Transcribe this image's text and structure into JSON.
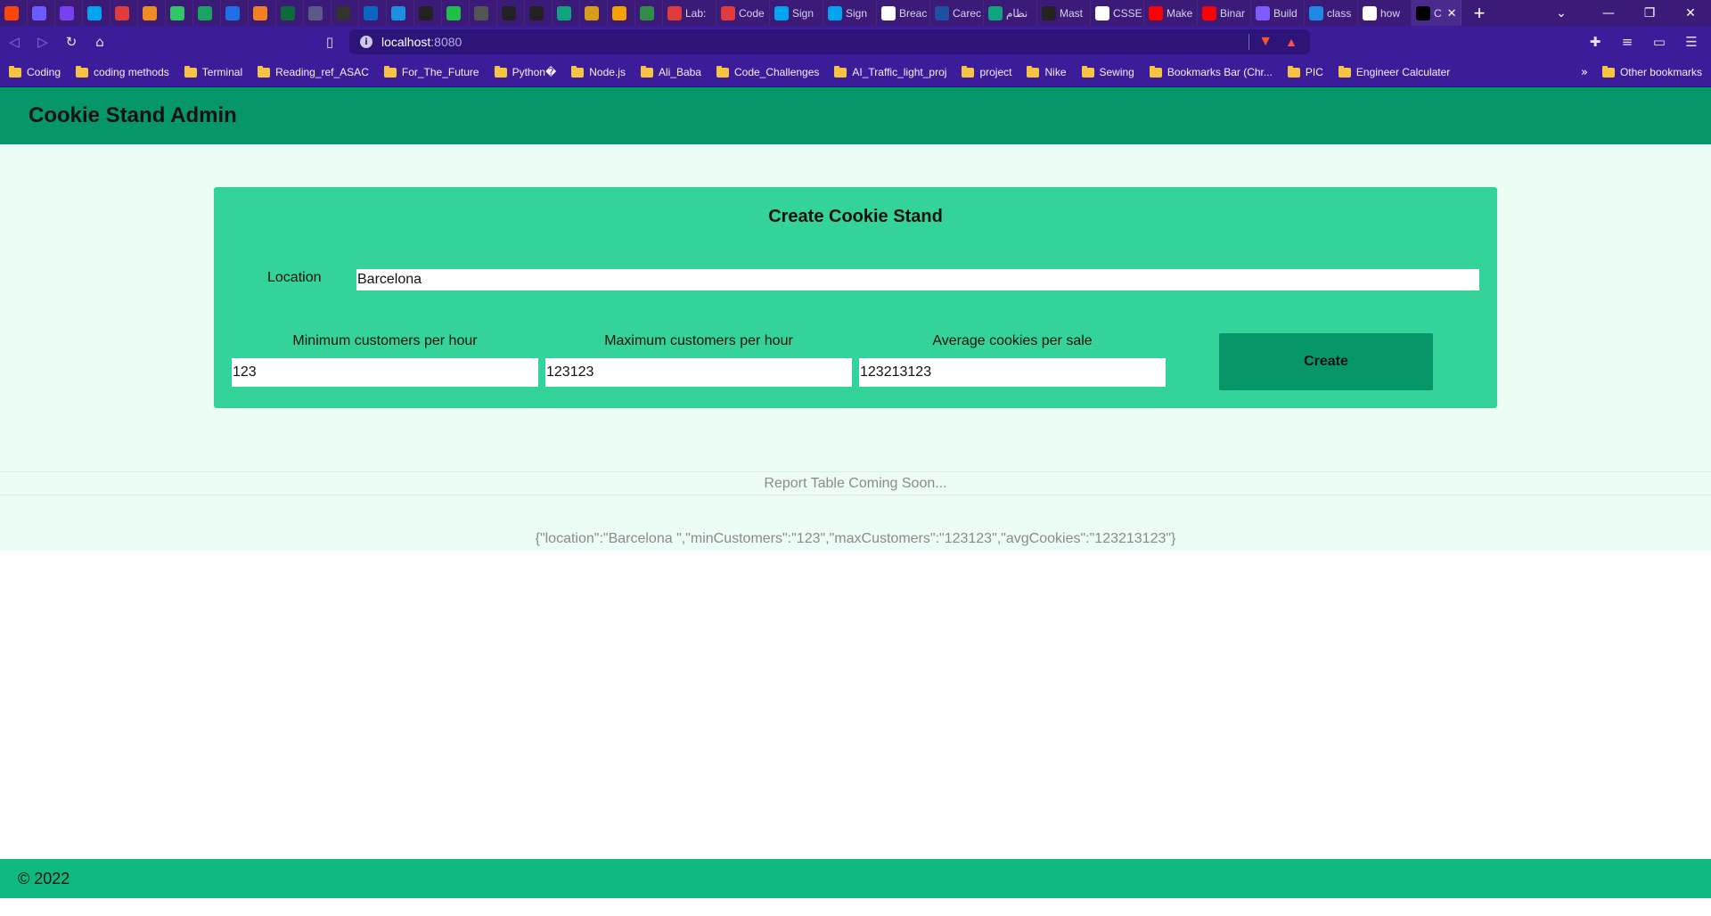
{
  "browser": {
    "tabs": [
      {
        "label": "",
        "icon": "reddit-icon",
        "color": "#ff4500"
      },
      {
        "label": "",
        "icon": "swirl-icon",
        "color": "#6b5cff"
      },
      {
        "label": "",
        "icon": "d-icon",
        "color": "#7b3ff2"
      },
      {
        "label": "",
        "icon": "microsoft-icon",
        "color": "#00a4ef"
      },
      {
        "label": "",
        "icon": "ring-icon",
        "color": "#e23b3b"
      },
      {
        "label": "",
        "icon": "pdf-icon",
        "color": "#f08c24"
      },
      {
        "label": "",
        "icon": "tc-icon",
        "color": "#2ec866"
      },
      {
        "label": "",
        "icon": "phone-icon",
        "color": "#1aa260"
      },
      {
        "label": "",
        "icon": "c-icon",
        "color": "#1e6fe8"
      },
      {
        "label": "",
        "icon": "stack-icon",
        "color": "#f48024"
      },
      {
        "label": "",
        "icon": "hr-icon",
        "color": "#0b6b3a"
      },
      {
        "label": "",
        "icon": "page-icon",
        "color": "#5a5a8a"
      },
      {
        "label": "",
        "icon": "mountain-icon",
        "color": "#333333"
      },
      {
        "label": "",
        "icon": "linkedin-icon",
        "color": "#0a66c2"
      },
      {
        "label": "",
        "icon": "play-icon",
        "color": "#1d8fe0"
      },
      {
        "label": "",
        "icon": "codeforces-icon",
        "color": "#222222"
      },
      {
        "label": "",
        "icon": "r-green-icon",
        "color": "#1ec04a"
      },
      {
        "label": "",
        "icon": "openai-icon",
        "color": "#555555"
      },
      {
        "label": "",
        "icon": "seven-icon",
        "color": "#222222"
      },
      {
        "label": "",
        "icon": "r-icon",
        "color": "#222222"
      },
      {
        "label": "",
        "icon": "gpt-icon",
        "color": "#10a37f"
      },
      {
        "label": "",
        "icon": "cookie-icon",
        "color": "#d89b1a"
      },
      {
        "label": "",
        "icon": "horseshoe-icon",
        "color": "#f4a100"
      },
      {
        "label": "",
        "icon": "gfg-icon",
        "color": "#2f8d46"
      },
      {
        "label": "Lab:",
        "icon": "ring-icon",
        "color": "#e23b3b"
      },
      {
        "label": "Code",
        "icon": "ring-icon",
        "color": "#e23b3b"
      },
      {
        "label": "Sign",
        "icon": "microsoft-icon",
        "color": "#00a4ef"
      },
      {
        "label": "Sign",
        "icon": "microsoft-icon",
        "color": "#00a4ef"
      },
      {
        "label": "Breac",
        "icon": "w-icon",
        "color": "#ffffff"
      },
      {
        "label": "Carec",
        "icon": "s-icon",
        "color": "#1f4fa0"
      },
      {
        "label": "نظام",
        "icon": "gpt-icon",
        "color": "#10a37f"
      },
      {
        "label": "Mast",
        "icon": "iu-icon",
        "color": "#222222"
      },
      {
        "label": "CSSE",
        "icon": "github-icon",
        "color": "#ffffff"
      },
      {
        "label": "Make",
        "icon": "youtube-icon",
        "color": "#ff0000"
      },
      {
        "label": "Binar",
        "icon": "youtube-icon",
        "color": "#ff0000"
      },
      {
        "label": "Build",
        "icon": "triangle-icon",
        "color": "#7c5cff"
      },
      {
        "label": "class",
        "icon": "cloud-icon",
        "color": "#1e88e5"
      },
      {
        "label": "how",
        "icon": "google-icon",
        "color": "#ffffff"
      },
      {
        "label": "C",
        "icon": "app-icon",
        "color": "#000000",
        "active": true
      }
    ],
    "address": {
      "host": "localhost",
      "port": ":8080"
    },
    "bookmarks": [
      "Coding",
      "coding methods",
      "Terminal",
      "Reading_ref_ASAC",
      "For_The_Future",
      "Python�",
      "Node.js",
      "Ali_Baba",
      "Code_Challenges",
      "AI_Traffic_light_proj",
      "project",
      "Nike",
      "Sewing",
      "Bookmarks Bar (Chr...",
      "PIC",
      "Engineer Calculater"
    ],
    "other_bookmarks": "Other bookmarks",
    "overflow": "»"
  },
  "header": {
    "title": "Cookie Stand Admin"
  },
  "form": {
    "title": "Create Cookie Stand",
    "location_label": "Location",
    "location_value": "Barcelona",
    "min_label": "Minimum customers per hour",
    "min_value": "123",
    "max_label": "Maximum customers per hour",
    "max_value": "123123",
    "avg_label": "Average cookies per sale",
    "avg_value": "123213123",
    "create_label": "Create"
  },
  "report": {
    "placeholder": "Report Table Coming Soon..."
  },
  "json_output": "{\"location\":\"Barcelona \",\"minCustomers\":\"123\",\"maxCustomers\":\"123123\",\"avgCookies\":\"123213123\"}",
  "footer": {
    "copyright": "© 2022"
  },
  "colors": {
    "header": "#059669",
    "main_bg": "#ecfdf5",
    "form_bg": "#34d399",
    "button": "#059669",
    "footer": "#10b981",
    "browser_frame": "#3b1a78"
  }
}
